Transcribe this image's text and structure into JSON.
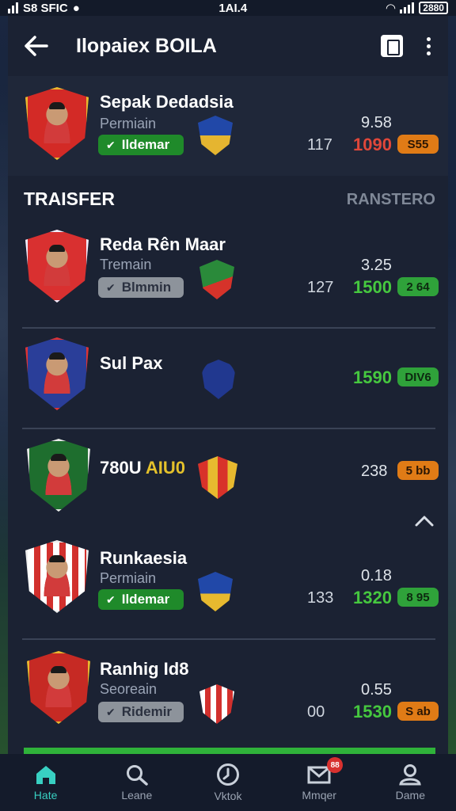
{
  "status_bar": {
    "left_text": "S8 SFIC",
    "time": "1AI.4",
    "battery": "2880"
  },
  "header": {
    "title": "Ilopaiex BOILA"
  },
  "featured": {
    "name": "Sepak Dedadsia",
    "subtitle": "Permiain",
    "badge": "Ildemar",
    "top_value": "9.58",
    "value_a": "117",
    "value_b": "1090",
    "value_b_color": "#e0473a",
    "tag": "S55",
    "tag_color": "#e07b16"
  },
  "section": {
    "title": "TRAISFER",
    "right_label": "RANSTERO"
  },
  "players": [
    {
      "name": "Reda Rên Maar",
      "subtitle": "Tremain",
      "badge": "Blmmin",
      "top_value": "3.25",
      "value_a": "127",
      "value_b": "1500",
      "tag": "2 64"
    },
    {
      "name": "Sul Pax",
      "subtitle": "",
      "badge": "",
      "top_value": "",
      "value_a": "",
      "value_b": "1590",
      "tag": "DIV6"
    },
    {
      "name": "780U",
      "name_accent": "AIU0",
      "subtitle": "",
      "badge": "",
      "top_value": "",
      "value_a": "",
      "value_b": "238",
      "tag": "5 bb"
    },
    {
      "name": "Runkaesia",
      "subtitle": "Permiain",
      "badge": "Ildemar",
      "top_value": "0.18",
      "value_a": "133",
      "value_b": "1320",
      "tag": "8 95"
    },
    {
      "name": "Ranhig Id8",
      "subtitle": "Seoreain",
      "badge": "Ridemir",
      "top_value": "0.55",
      "value_a": "00",
      "value_b": "1530",
      "tag": "S ab"
    }
  ],
  "bottom_nav": [
    {
      "label": "Hate",
      "icon": "home-icon",
      "active": true
    },
    {
      "label": "Leane",
      "icon": "search-icon"
    },
    {
      "label": "Vktok",
      "icon": "clock-icon"
    },
    {
      "label": "Mmqer",
      "icon": "mail-icon",
      "badge": "88"
    },
    {
      "label": "Dame",
      "icon": "profile-icon"
    }
  ],
  "colors": {
    "accent_teal": "#38d0c2",
    "positive_green": "#46c83f",
    "warning_orange": "#e07b16",
    "negative_red": "#e0473a"
  }
}
